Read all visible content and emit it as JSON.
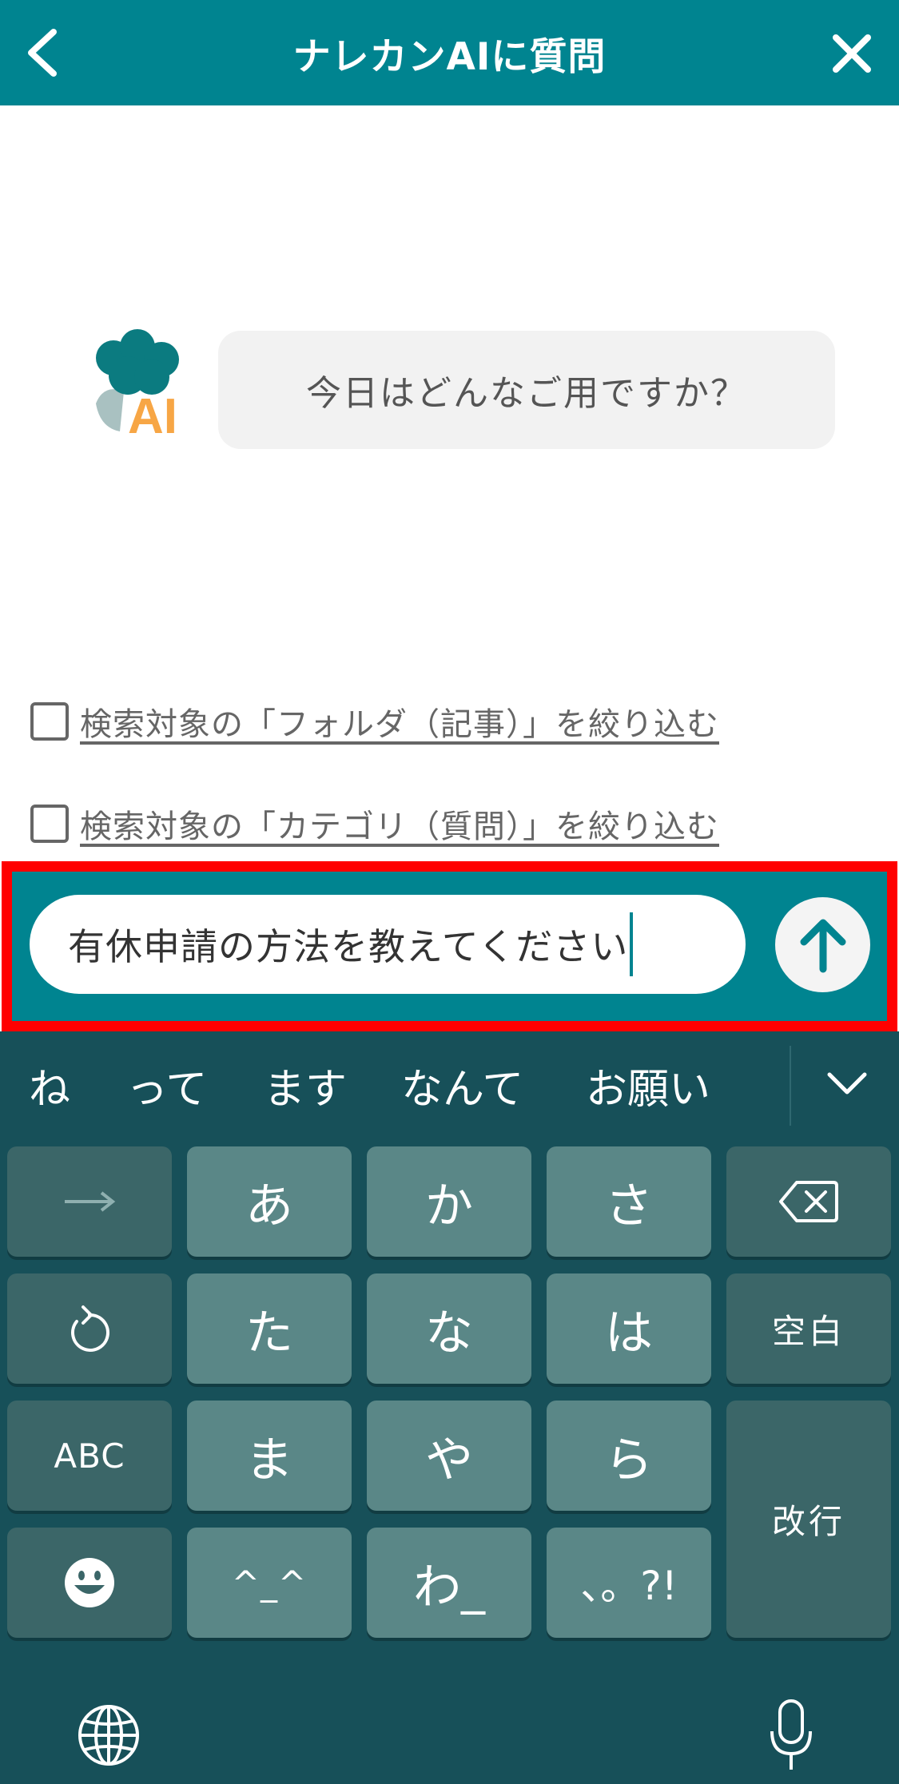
{
  "header": {
    "title": "ナレカンAIに質問",
    "back_icon": "chevron-left-icon",
    "close_icon": "close-icon",
    "color": "#008490"
  },
  "chat": {
    "bot_avatar_label": "AI",
    "greeting": "今日はどんなご用ですか？"
  },
  "filters": [
    {
      "label": "検索対象の「フォルダ（記事）」を絞り込む",
      "checked": false
    },
    {
      "label": "検索対象の「カテゴリ（質問）」を絞り込む",
      "checked": false
    }
  ],
  "input": {
    "value": "有休申請の方法を教えてください",
    "send_icon": "arrow-up-icon"
  },
  "keyboard": {
    "candidates": [
      "ね",
      "って",
      "ます",
      "なんて",
      "お願い"
    ],
    "rows": [
      [
        "→",
        "あ",
        "か",
        "さ",
        "⌫"
      ],
      [
        "↺",
        "た",
        "な",
        "は",
        "空白"
      ],
      [
        "ABC",
        "ま",
        "や",
        "ら",
        "改行"
      ],
      [
        "☺",
        "^_^",
        "わ_",
        "、。?!"
      ]
    ],
    "space_label": "空白",
    "return_label": "改行",
    "abc_label": "ABC",
    "face_label": "^_^",
    "wa_label": "わ_",
    "punct_label": "、。?!"
  }
}
